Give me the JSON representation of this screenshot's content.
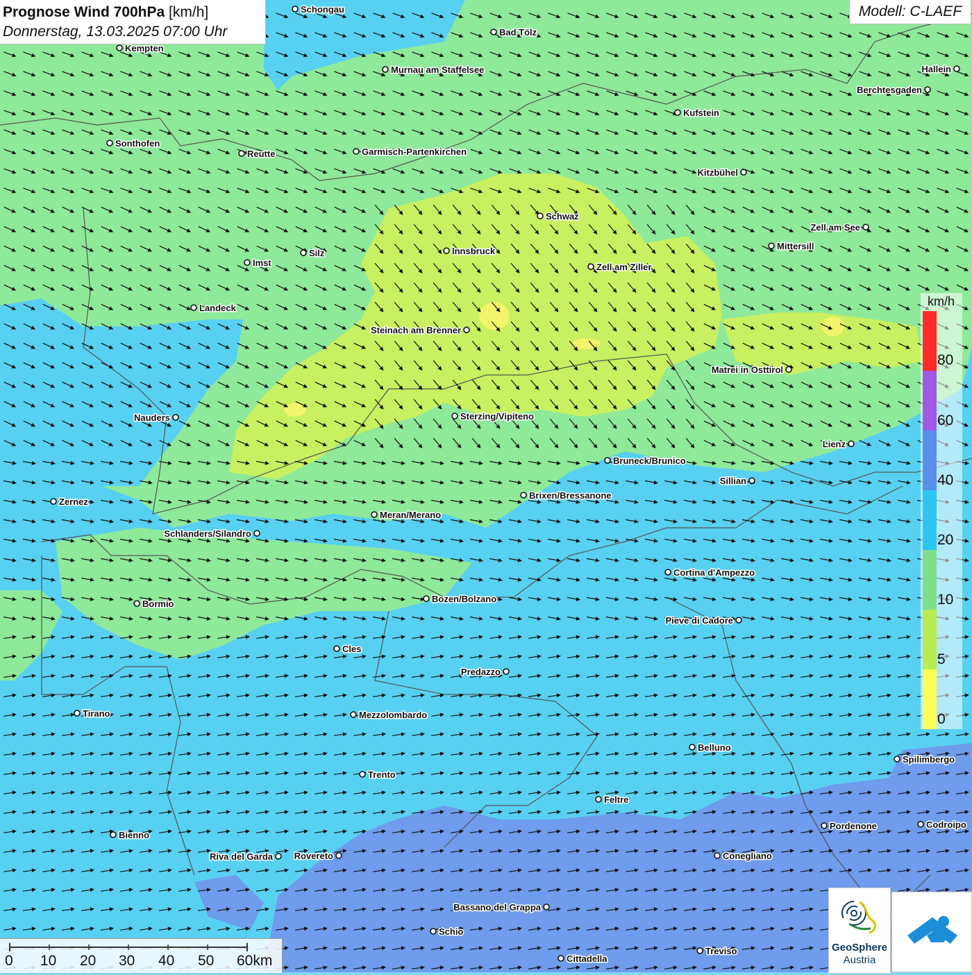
{
  "title": {
    "main": "Prognose Wind 700hPa",
    "unit": "[km/h]",
    "date": "Donnerstag, 13.03.2025 07:00 Uhr"
  },
  "model": "Modell: C-LAEF",
  "legend": {
    "unit": "km/h",
    "labels": [
      "80",
      "60",
      "40",
      "20",
      "10",
      "5",
      "0"
    ],
    "colors": [
      "#ff2a2a",
      "#a05ae6",
      "#5a8ee8",
      "#2ec6f0",
      "#7ee08a",
      "#b8ec52",
      "#ffff5a"
    ]
  },
  "scale": {
    "labels": [
      "0",
      "10",
      "20",
      "30",
      "40",
      "50",
      "60km"
    ]
  },
  "logo": {
    "line1": "GeoSphere",
    "line2": "Austria"
  },
  "cities": [
    {
      "name": "Schongau"
    },
    {
      "name": "Kempten"
    },
    {
      "name": "Bad Tölz"
    },
    {
      "name": "Murnau am Staffelsee"
    },
    {
      "name": "Hallein"
    },
    {
      "name": "Berchtesgaden"
    },
    {
      "name": "Kufstein"
    },
    {
      "name": "Sonthofen"
    },
    {
      "name": "Reutte"
    },
    {
      "name": "Garmisch-Partenkirchen"
    },
    {
      "name": "Kitzbühel"
    },
    {
      "name": "Schwaz"
    },
    {
      "name": "Zell am See"
    },
    {
      "name": "Innsbruck"
    },
    {
      "name": "Mittersill"
    },
    {
      "name": "Silz"
    },
    {
      "name": "Imst"
    },
    {
      "name": "Zell am Ziller"
    },
    {
      "name": "Landeck"
    },
    {
      "name": "Steinach am Brenner"
    },
    {
      "name": "Matrei in Osttirol"
    },
    {
      "name": "Nauders"
    },
    {
      "name": "Sterzing/Vipiteno"
    },
    {
      "name": "Lienz"
    },
    {
      "name": "Bruneck/Brunico"
    },
    {
      "name": "Sillian"
    },
    {
      "name": "Zernez"
    },
    {
      "name": "Brixen/Bressanone"
    },
    {
      "name": "Meran/Merano"
    },
    {
      "name": "Schlanders/Silandro"
    },
    {
      "name": "Cortina d'Ampezzo"
    },
    {
      "name": "Bozen/Bolzano"
    },
    {
      "name": "Bormio"
    },
    {
      "name": "Pieve di Cadore"
    },
    {
      "name": "Cles"
    },
    {
      "name": "Predazzo"
    },
    {
      "name": "Tirano"
    },
    {
      "name": "Mezzolombardo"
    },
    {
      "name": "Belluno"
    },
    {
      "name": "Spilimbergo"
    },
    {
      "name": "Trento"
    },
    {
      "name": "Feltre"
    },
    {
      "name": "Pordenone"
    },
    {
      "name": "Codroipo"
    },
    {
      "name": "Bienno"
    },
    {
      "name": "Riva del Garda"
    },
    {
      "name": "Rovereto"
    },
    {
      "name": "Conegliano"
    },
    {
      "name": "Bassano del Grappa"
    },
    {
      "name": "Schio"
    },
    {
      "name": "Treviso"
    },
    {
      "name": "Cittadella"
    }
  ]
}
